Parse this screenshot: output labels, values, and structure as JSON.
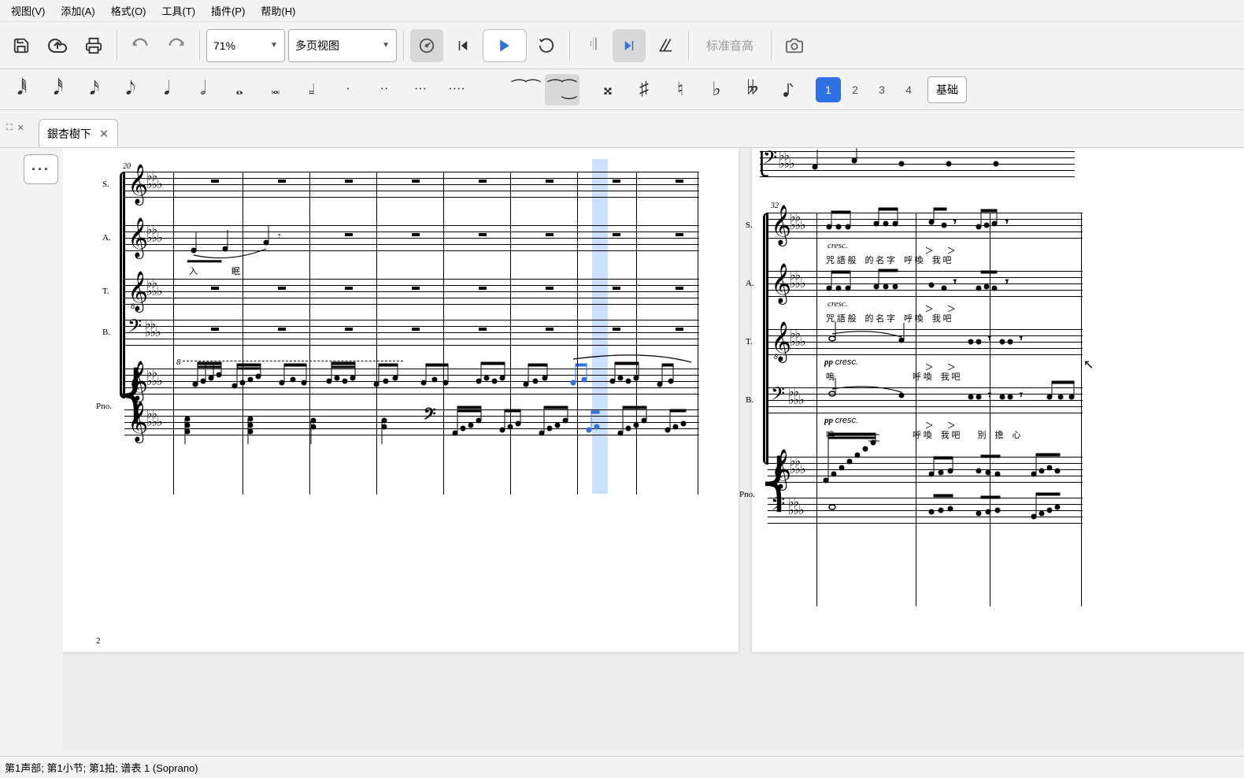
{
  "menu": {
    "view": "视图(V)",
    "add": "添加(A)",
    "format": "格式(O)",
    "tools": "工具(T)",
    "plugins": "插件(P)",
    "help": "帮助(H)"
  },
  "toolbar": {
    "zoom": "71%",
    "viewmode": "多页视图",
    "pitch_label": "标准音高"
  },
  "voices": {
    "v1": "1",
    "v2": "2",
    "v3": "3",
    "v4": "4"
  },
  "layer": {
    "basic": "基础"
  },
  "tab": {
    "title": "銀杏樹下"
  },
  "score": {
    "page_left": {
      "measure_start": "20",
      "parts": {
        "s": "S.",
        "a": "A.",
        "t": "T.",
        "b": "B.",
        "pno": "Pno."
      },
      "lyric_a": "入　眠",
      "ottava": "8",
      "page_num": "2"
    },
    "page_right": {
      "measure_start": "32",
      "parts": {
        "s": "S.",
        "a": "A.",
        "t": "T.",
        "b": "B.",
        "pno": "Pno."
      },
      "lyric_sa": "咒 語 般　的 名 字　呼 喚　我 吧",
      "lyric_t": "嗚　　　　　　　　　呼 喚　我 吧",
      "lyric_b": "嗚　　　　　　　　　呼 喚　我 吧　　別　擔　心",
      "dyn_cresc": "cresc.",
      "dyn_pp": "pp",
      "dyn_pp_cresc": "pp cresc."
    }
  },
  "status": "第1声部;  第1小节; 第1拍; 谱表 1 (Soprano)"
}
